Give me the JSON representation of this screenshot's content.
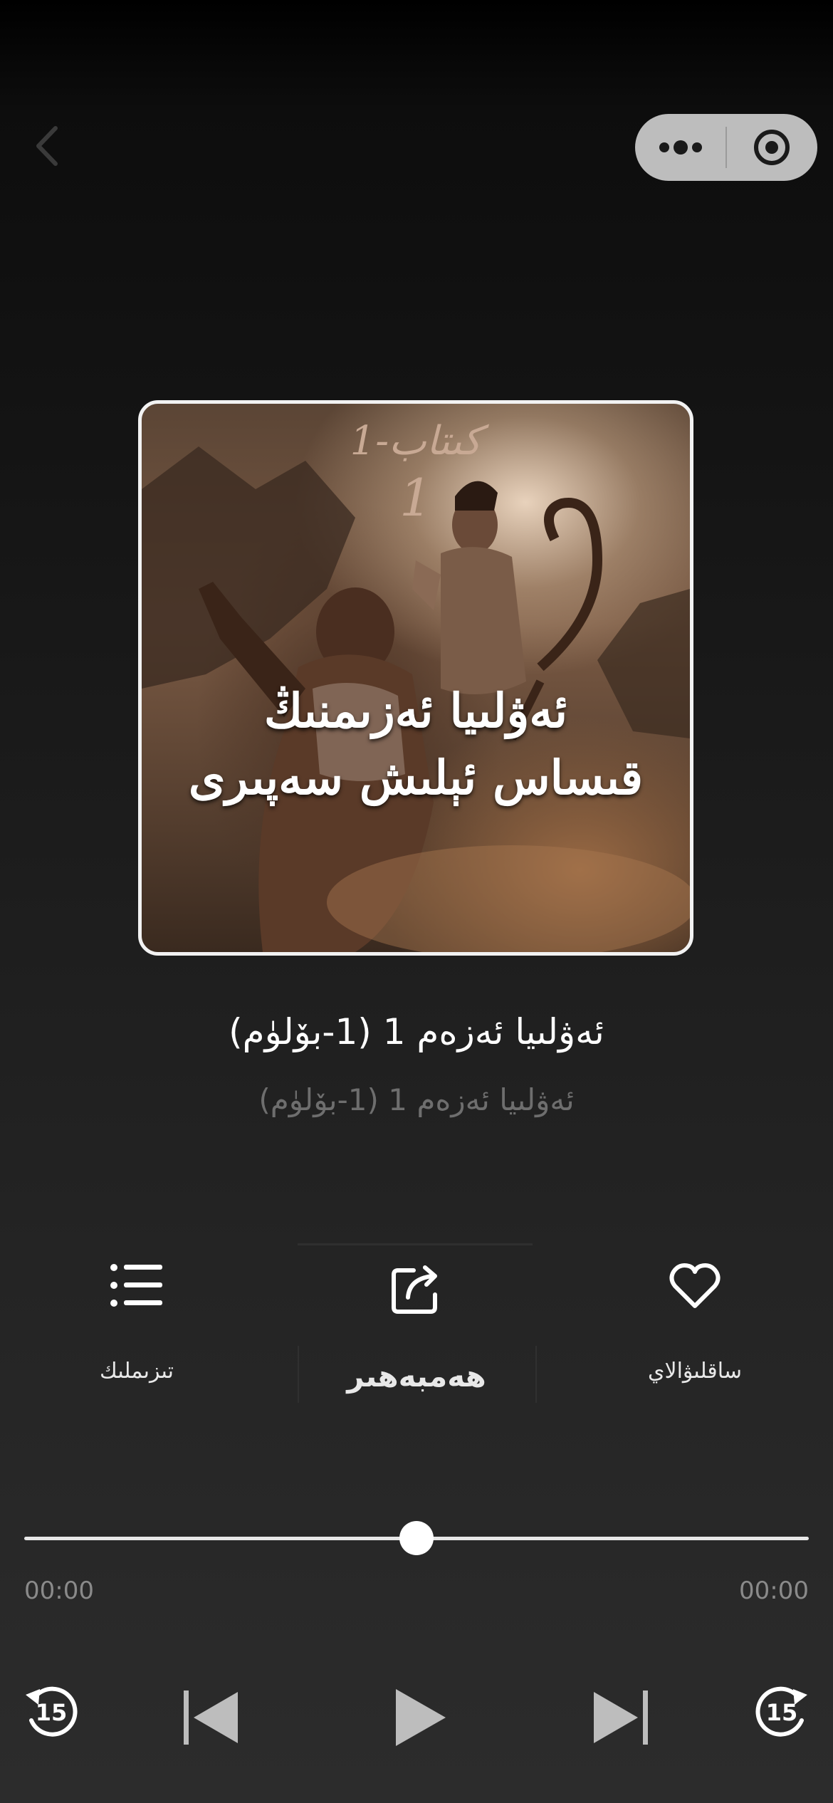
{
  "navigation": {
    "back_icon": "chevron-left-icon"
  },
  "capsule": {
    "more_icon": "more-dots-icon",
    "close_icon": "target-close-icon"
  },
  "cover": {
    "line1": "1-كىتاب",
    "line2": "1",
    "line3": "ئەۋلىيا ئەزىمنىڭ",
    "line4": "قىساس ئېلىش سەپىرى"
  },
  "track": {
    "title": "ئەۋلىيا ئەزەم 1 (1-بۆلۈم)",
    "subtitle": "ئەۋلىيا ئەزەم 1 (1-بۆلۈم)"
  },
  "actions": {
    "playlist_label": "تىزىملىك",
    "share_label": "ھەمبەھىر",
    "favorite_label": "ساقلىۋالاي"
  },
  "progress": {
    "elapsed": "00:00",
    "total": "00:00",
    "position": 0.5
  },
  "controls": {
    "rewind_label": "15",
    "forward_label": "15"
  },
  "colors": {
    "background_top": "#000000",
    "background_bottom": "#2c2c2c",
    "capsule": "#bdbdbd",
    "subtitle": "#6e6e6e",
    "disabled_control": "#bdbdbd"
  }
}
